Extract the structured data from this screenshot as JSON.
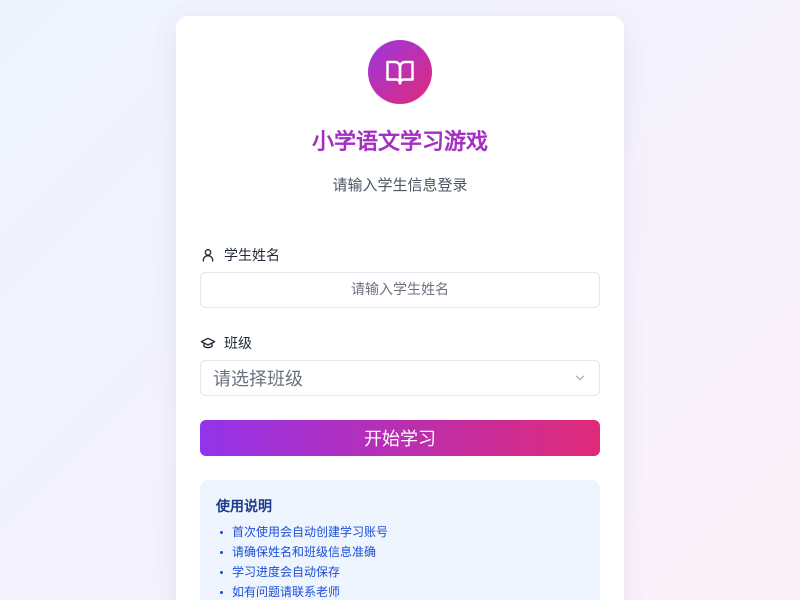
{
  "app": {
    "title": "小学语文学习游戏",
    "subtitle": "请输入学生信息登录"
  },
  "form": {
    "name_label": "学生姓名",
    "name_placeholder": "请输入学生姓名",
    "name_value": "",
    "class_label": "班级",
    "class_placeholder": "请选择班级",
    "submit_label": "开始学习"
  },
  "instructions": {
    "title": "使用说明",
    "items": [
      "首次使用会自动创建学习账号",
      "请确保姓名和班级信息准确",
      "学习进度会自动保存",
      "如有问题请联系老师"
    ]
  },
  "icons": {
    "logo": "book-open-icon",
    "name": "user-icon",
    "class": "graduation-cap-icon",
    "select": "chevron-down-icon"
  },
  "colors": {
    "accent_start": "#9333ea",
    "accent_end": "#e02a78",
    "title": "#a52ec3",
    "info_bg": "#eef5fe",
    "info_text": "#1d4ed8"
  }
}
